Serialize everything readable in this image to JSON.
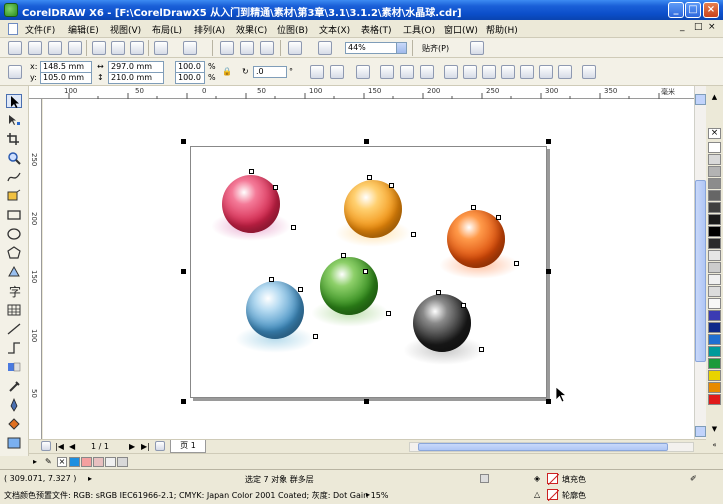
{
  "window": {
    "title": "CorelDRAW X6 - [F:\\CorelDrawX5  从入门到精通\\素材\\第3章\\3.1\\3.1.2\\素材\\水晶球.cdr]",
    "min_label": "_",
    "max_label": "□",
    "close_label": "×"
  },
  "menu": {
    "items": [
      "文件(F)",
      "编辑(E)",
      "视图(V)",
      "布局(L)",
      "排列(A)",
      "效果(C)",
      "位图(B)",
      "文本(X)",
      "表格(T)",
      "工具(O)",
      "窗口(W)",
      "帮助(H)"
    ],
    "doc_min": "_",
    "doc_max": "□",
    "doc_close": "×"
  },
  "standard_toolbar": {
    "zoom_value": "44%",
    "snap_label": "贴齐(P)"
  },
  "property_bar": {
    "x_label": "x:",
    "x_value": "148.5 mm",
    "y_label": "y:",
    "y_value": "105.0 mm",
    "w_value": "297.0 mm",
    "h_value": "210.0 mm",
    "scale_w": "100.0",
    "scale_h": "100.0",
    "percent": "%",
    "angle_value": ".0",
    "angle_unit": "°"
  },
  "ruler": {
    "top_labels": [
      "100",
      "50",
      "0",
      "50",
      "100",
      "150",
      "200",
      "250",
      "300",
      "350"
    ],
    "left_labels": [
      "250",
      "200",
      "150",
      "100",
      "50"
    ],
    "unit": "毫米"
  },
  "page_nav": {
    "count": "1 / 1",
    "tab": "页 1"
  },
  "status": {
    "coords": "( 309.071, 7.327 )",
    "selection": "选定 7 对象 群多层",
    "fill_label": "填充色",
    "outline_label": "轮廓色",
    "color_profile": "文档颜色预置文件: RGB: sRGB IEC61966-2.1; CMYK: Japan Color 2001 Coated; 灰度: Dot Gain 15%"
  },
  "palette": {
    "colors": [
      "#ffffff",
      "#d9d9d9",
      "#b3b3b3",
      "#8c8c8c",
      "#666666",
      "#404040",
      "#1a1a1a",
      "#000000",
      "#2b2b2b",
      "#e6e6e6",
      "#cccccc",
      "#f0f0f0",
      "#dcdcdc",
      "#f7f7f7",
      "#3b3bb3",
      "#0f2a8a",
      "#1f6fd1",
      "#009a9a",
      "#1a9a3a",
      "#e8d300",
      "#e88a00",
      "#e01a1a",
      "#c0107a",
      "#8a1a8a",
      "#ffffff",
      "#e0e0e0",
      "#f5f5f5"
    ]
  },
  "doc_palette": {
    "colors": [
      "#1e8fe0",
      "#f4a0a0",
      "#e8c0c0",
      "#f0f0f0",
      "#d8d8d8"
    ]
  },
  "balls": [
    {
      "name": "red",
      "color": "#d1234a",
      "light": "#f47a98",
      "shadow": "#e8a9cf"
    },
    {
      "name": "orange",
      "color": "#f08c0a",
      "light": "#ffd070",
      "shadow": "#ffe3b0"
    },
    {
      "name": "dark-orange",
      "color": "#d94a08",
      "light": "#ff9a4a",
      "shadow": "#ffc0a0"
    },
    {
      "name": "blue",
      "color": "#3e8cc0",
      "light": "#b8dcf2",
      "shadow": "#b8dcec"
    },
    {
      "name": "green",
      "color": "#2f8a1a",
      "light": "#8ed06a",
      "shadow": "#c0e0b0"
    },
    {
      "name": "black",
      "color": "#1a1a1a",
      "light": "#8a8a8a",
      "shadow": "#c8c8c8"
    }
  ]
}
